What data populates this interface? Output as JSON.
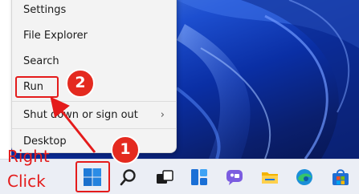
{
  "menu": {
    "items": [
      {
        "label": "Settings"
      },
      {
        "label": "File Explorer"
      },
      {
        "label": "Search"
      },
      {
        "label": "Run"
      },
      {
        "label": "Shut down or sign out",
        "chevron": "›"
      },
      {
        "label": "Desktop"
      }
    ]
  },
  "annotations": {
    "badge_1": "1",
    "badge_2": "2",
    "right_click_line1": "Right",
    "right_click_line2": "Click",
    "accent_color": "#e41b1b"
  },
  "taskbar": {
    "icons": [
      "windows-start-icon",
      "search-icon",
      "task-view-icon",
      "widgets-icon",
      "chat-icon",
      "file-explorer-icon",
      "edge-icon",
      "store-icon"
    ]
  }
}
